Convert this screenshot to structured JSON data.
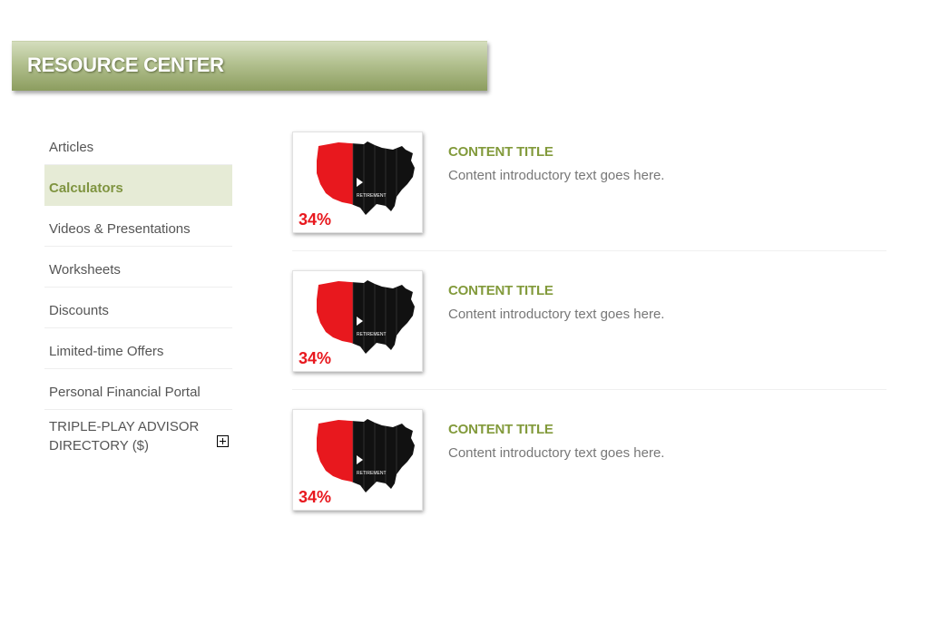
{
  "header": {
    "title": "RESOURCE CENTER"
  },
  "sidebar": {
    "items": [
      {
        "label": "Articles",
        "active": false
      },
      {
        "label": "Calculators",
        "active": true
      },
      {
        "label": "Videos & Presentations",
        "active": false
      },
      {
        "label": "Worksheets",
        "active": false
      },
      {
        "label": "Discounts",
        "active": false
      },
      {
        "label": "Limited-time Offers",
        "active": false
      },
      {
        "label": "Personal Financial Portal",
        "active": false
      },
      {
        "label": "TRIPLE-PLAY ADVISOR DIRECTORY ($)",
        "active": false,
        "expand_icon": "plus-box-icon"
      }
    ]
  },
  "content": {
    "items": [
      {
        "title": "CONTENT TITLE",
        "text": "Content introductory text goes here.",
        "thumbnail": {
          "percent": "34%",
          "icon": "play-icon",
          "caption": "RETIREMENT"
        }
      },
      {
        "title": "CONTENT TITLE",
        "text": "Content introductory text goes here.",
        "thumbnail": {
          "percent": "34%",
          "icon": "play-icon",
          "caption": "RETIREMENT"
        }
      },
      {
        "title": "CONTENT TITLE",
        "text": "Content introductory text goes here.",
        "thumbnail": {
          "percent": "34%",
          "icon": "play-icon",
          "caption": "RETIREMENT"
        }
      }
    ]
  },
  "colors": {
    "accent_green": "#829a3b",
    "active_bg": "#e6ebd6",
    "map_red": "#e8181e",
    "map_black": "#111111"
  }
}
